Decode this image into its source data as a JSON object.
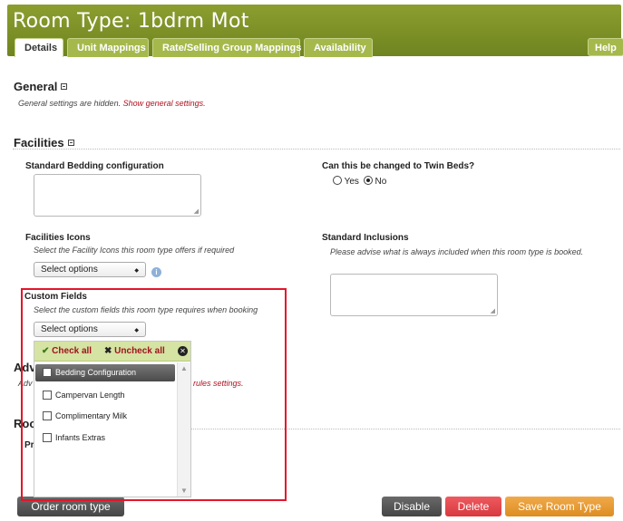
{
  "header": {
    "title": "Room Type: 1bdrm Mot"
  },
  "tabs": [
    {
      "label": "Details",
      "active": true
    },
    {
      "label": "Unit Mappings",
      "active": false
    },
    {
      "label": "Rate/Selling Group Mappings",
      "active": false
    },
    {
      "label": "Availability",
      "active": false
    }
  ],
  "help_label": "Help",
  "general": {
    "heading": "General",
    "note_prefix": "General settings are hidden.",
    "note_link": "Show general settings."
  },
  "facilities": {
    "heading": "Facilities",
    "standard_bedding_label": "Standard Bedding configuration",
    "twin_question": "Can this be changed to Twin Beds?",
    "twin_options": [
      "Yes",
      "No"
    ],
    "twin_selected": "No",
    "icons_label": "Facilities Icons",
    "icons_note": "Select the Facility Icons this room type offers if required",
    "icons_select": "Select options",
    "inclusions_label": "Standard Inclusions",
    "inclusions_note": "Please advise what is always included when this room type is booked.",
    "custom_fields_label": "Custom Fields",
    "custom_fields_note": "Select the custom fields this room type requires when booking",
    "custom_fields_select": "Select options"
  },
  "dropdown": {
    "check_all": "Check all",
    "uncheck_all": "Uncheck all",
    "options": [
      "Bedding Configuration",
      "Campervan Length",
      "Complimentary Milk",
      "Infants Extras"
    ],
    "highlighted_index": 0
  },
  "hidden_sections": {
    "adv_partial": "Adv",
    "adv_note_partial": "Adv",
    "adv_link_partial": "rules settings.",
    "room_partial": "Roo",
    "pr_partial": "Pr"
  },
  "buttons": {
    "order": "Order room type",
    "disable": "Disable",
    "delete": "Delete",
    "save": "Save Room Type"
  },
  "colors": {
    "header": "#7a8e26",
    "tab": "#a5b84c",
    "link_red": "#b0111f",
    "highlight_box": "#e3162a",
    "btn_gray": "#555555",
    "btn_red": "#e0474c",
    "btn_orange": "#e4992f"
  }
}
